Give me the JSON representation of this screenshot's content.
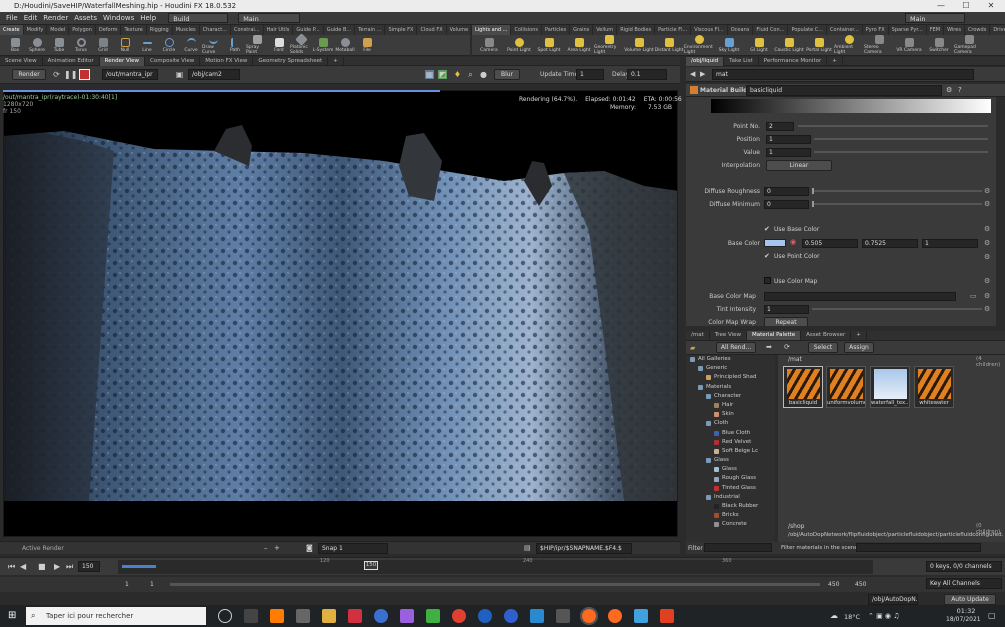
{
  "window": {
    "title": "D:/Houdini/SaveHIP/WaterfallMeshing.hip - Houdini FX 18.0.532",
    "minimize": "—",
    "maximize": "☐",
    "close": "✕"
  },
  "menubar": {
    "items": [
      "File",
      "Edit",
      "Render",
      "Assets",
      "Windows",
      "Help"
    ],
    "build": "Build",
    "desktop": "Main",
    "right_desktop": "Main"
  },
  "shelf_tabs_left": [
    "Create",
    "Modify",
    "Model",
    "Polygon",
    "Deform",
    "Texture",
    "Rigging",
    "Muscles",
    "Charact...",
    "Constrai...",
    "Hair Utils",
    "Guide P...",
    "Guide B...",
    "Terrain ...",
    "Simple FX",
    "Cloud FX",
    "Volume"
  ],
  "shelf_tabs_right": [
    "Lights and ...",
    "Collisions",
    "Particles",
    "Grains",
    "Vellum",
    "Rigid Bodies",
    "Particle Fl...",
    "Viscous Fl...",
    "Oceans",
    "Fluid Con...",
    "Populate C...",
    "Container...",
    "Pyro FX",
    "Sparse Pyr...",
    "FEM",
    "Wires",
    "Crowds",
    "Drive Sim..."
  ],
  "tools_left": [
    "Box",
    "Sphere",
    "Tube",
    "Torus",
    "Grid",
    "Null",
    "Line",
    "Circle",
    "Curve",
    "Draw Curve",
    "Path",
    "Spray Paint",
    "Font",
    "Platonic Solids",
    "L-System",
    "Metaball",
    "File"
  ],
  "tools_right": [
    "Camera",
    "Point Light",
    "Spot Light",
    "Area Light",
    "Geometry Light",
    "Volume Light",
    "Distant Light",
    "Environment Light",
    "Sky Light",
    "GI Light",
    "Caustic Light",
    "Portal Light",
    "Ambient Light",
    "Stereo Camera",
    "VR Camera",
    "Switcher",
    "Gamepad Camera"
  ],
  "left_pane_tabs": [
    "Scene View",
    "Animation Editor",
    "Render View",
    "Composite View",
    "Motion FX View",
    "Geometry Spreadsheet"
  ],
  "render_toolbar": {
    "render_button": "Render",
    "rop_path": "/out/mantra_ipr",
    "camera_path": "/obj/cam2",
    "blur": "Blur",
    "update_time_label": "Update Time",
    "update_time": "1",
    "delay_label": "Delay",
    "delay": "0.1"
  },
  "viewport": {
    "info_line1": "/out/mantra_ipr(raytrace)-01:30:40[1]",
    "info_line2": "1280x720",
    "info_line3": "fr 150",
    "status_rendering": "Rendering (64.7%).",
    "elapsed": "Elapsed: 0:01:42",
    "eta": "ETA: 0:00:56",
    "memory_label": "Memory:",
    "memory": "7.53 GB",
    "progress": 0.647
  },
  "bottom_left": {
    "active_render": "Active Render",
    "snap": "Snap 1",
    "hip_path": "$HIP/ipr/$SNAPNAME.$F4.$"
  },
  "right_top_tabs": [
    "/obj/liquid",
    "Take List",
    "Performance Monitor"
  ],
  "param_pane": {
    "path": "mat",
    "node_type": "Material Builder",
    "node_name": "basicliquid",
    "params": [
      {
        "label": "Point No.",
        "value": "2"
      },
      {
        "label": "Position",
        "value": "1"
      },
      {
        "label": "Value",
        "value": "1"
      },
      {
        "label": "Interpolation",
        "value": "Linear"
      },
      {
        "label": "Diffuse Roughness",
        "value": "0"
      },
      {
        "label": "Diffuse Minimum",
        "value": "0"
      },
      {
        "label": "Use Base Color",
        "value": "✔"
      },
      {
        "label": "Base Color",
        "value": "0.505",
        "value2": "0.7525",
        "value3": "1"
      },
      {
        "label": "Use Point Color",
        "value": "✔"
      },
      {
        "label": "Use Color Map",
        "value": ""
      },
      {
        "label": "Base Color Map",
        "value": ""
      },
      {
        "label": "Tint Intensity",
        "value": "1"
      },
      {
        "label": "Color Map Wrap",
        "value": "Repeat"
      }
    ]
  },
  "right_mid_tabs": [
    "/mat",
    "Tree View",
    "Material Palette",
    "Asset Browser"
  ],
  "gallery_toolbar": {
    "filter": "All Rend...",
    "select": "Select",
    "assign": "Assign"
  },
  "tree": [
    {
      "label": "All Galleries",
      "color": "#7a9ab8",
      "indent": 0
    },
    {
      "label": "Generic",
      "color": "#7a9ab8",
      "indent": 1
    },
    {
      "label": "Principled Shad",
      "color": "#c8a060",
      "indent": 2
    },
    {
      "label": "Materials",
      "color": "#7a9ab8",
      "indent": 1
    },
    {
      "label": "Character",
      "color": "#7a9ab8",
      "indent": 2
    },
    {
      "label": "Hair",
      "color": "#a08060",
      "indent": 3
    },
    {
      "label": "Skin",
      "color": "#d09070",
      "indent": 3
    },
    {
      "label": "Cloth",
      "color": "#7a9ab8",
      "indent": 2
    },
    {
      "label": "Blue Cloth",
      "color": "#4060b0",
      "indent": 3
    },
    {
      "label": "Red Velvet",
      "color": "#b03030",
      "indent": 3
    },
    {
      "label": "Soft Beige Lc",
      "color": "#c8b090",
      "indent": 3
    },
    {
      "label": "Glass",
      "color": "#7a9ab8",
      "indent": 2
    },
    {
      "label": "Glass",
      "color": "#a0c0d0",
      "indent": 3
    },
    {
      "label": "Rough Glass",
      "color": "#90a8b8",
      "indent": 3
    },
    {
      "label": "Tinted Glass",
      "color": "#c03030",
      "indent": 3
    },
    {
      "label": "Industrial",
      "color": "#7a9ab8",
      "indent": 2
    },
    {
      "label": "Black Rubber",
      "color": "#222222",
      "indent": 3
    },
    {
      "label": "Bricks",
      "color": "#a05030",
      "indent": 3
    },
    {
      "label": "Concrete",
      "color": "#909090",
      "indent": 3
    }
  ],
  "gallery": {
    "path": "/mat",
    "count": "(4 children)",
    "items": [
      "basicliquid",
      "uniformvolume",
      "waterfall_tex...",
      "whitewater"
    ],
    "shop_path": "/shop",
    "shop_count": "(0 children)",
    "network_path": "/obj/AutoDopNetwork/flipfluidobject/particlefluidobject/particlefluidconfigured..."
  },
  "filter_bar": {
    "filter_label": "Filter",
    "materials_filter": "Filter materials in the scene:"
  },
  "timeline": {
    "frame": "150",
    "start": "1",
    "end": "450",
    "tick_labels": [
      "120",
      "150",
      "240",
      "360"
    ],
    "keys": "0 keys, 0/0 channels",
    "key_all": "Key All Channels",
    "auto_update": "Auto Update",
    "status_path": "/obj/AutoDopN...",
    "range_start": "1",
    "range_start2": "1",
    "range_end": "450",
    "range_end2": "450"
  },
  "taskbar": {
    "search": "Taper ici pour rechercher",
    "temp": "18°C",
    "time": "01:32",
    "date": "18/07/2021"
  }
}
